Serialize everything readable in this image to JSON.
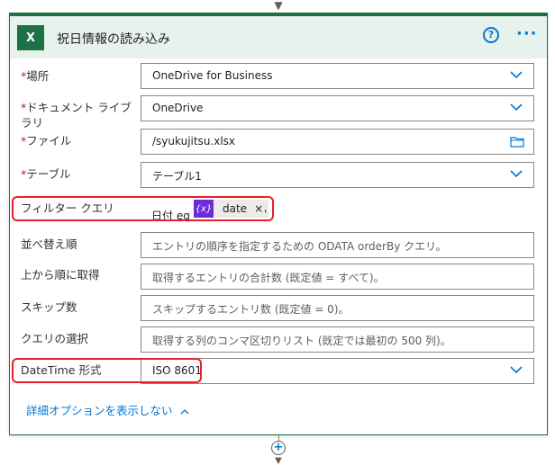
{
  "card": {
    "title": "祝日情報の読み込み",
    "help_glyph": "?",
    "more_glyph": "···",
    "icon_letter": "X"
  },
  "fields": [
    {
      "label": "場所",
      "required": true,
      "value": "OneDrive for Business",
      "control": "dropdown"
    },
    {
      "label": "ドキュメント ライブラリ",
      "required": true,
      "value": "OneDrive",
      "control": "dropdown"
    },
    {
      "label": "ファイル",
      "required": true,
      "value": "/syukujitsu.xlsx",
      "control": "file-picker"
    },
    {
      "label": "テーブル",
      "required": true,
      "value": "テーブル1",
      "control": "dropdown"
    },
    {
      "label": "フィルター クエリ",
      "required": false,
      "value_prefix": "日付 eq '",
      "token_icon": "{x}",
      "token_label": "date",
      "token_close": "×",
      "value_suffix": "'",
      "control": "expression"
    },
    {
      "label": "並べ替え順",
      "required": false,
      "placeholder": "エントリの順序を指定するための ODATA orderBy クエリ。",
      "control": "text"
    },
    {
      "label": "上から順に取得",
      "required": false,
      "placeholder": "取得するエントリの合計数 (既定値 = すべて)。",
      "control": "text"
    },
    {
      "label": "スキップ数",
      "required": false,
      "placeholder": "スキップするエントリ数 (既定値 = 0)。",
      "control": "text"
    },
    {
      "label": "クエリの選択",
      "required": false,
      "placeholder": "取得する列のコンマ区切りリスト (既定では最初の 500 列)。",
      "control": "text"
    },
    {
      "label": "DateTime 形式",
      "required": false,
      "value": "ISO 8601",
      "control": "dropdown"
    }
  ],
  "advanced_toggle": "詳細オプションを表示しない",
  "add_step_glyph": "+",
  "required_marker": "*",
  "colors": {
    "brand": "#1e7145",
    "accent": "#0078d4",
    "token": "#6d2bd9",
    "highlight": "#e8202a"
  }
}
